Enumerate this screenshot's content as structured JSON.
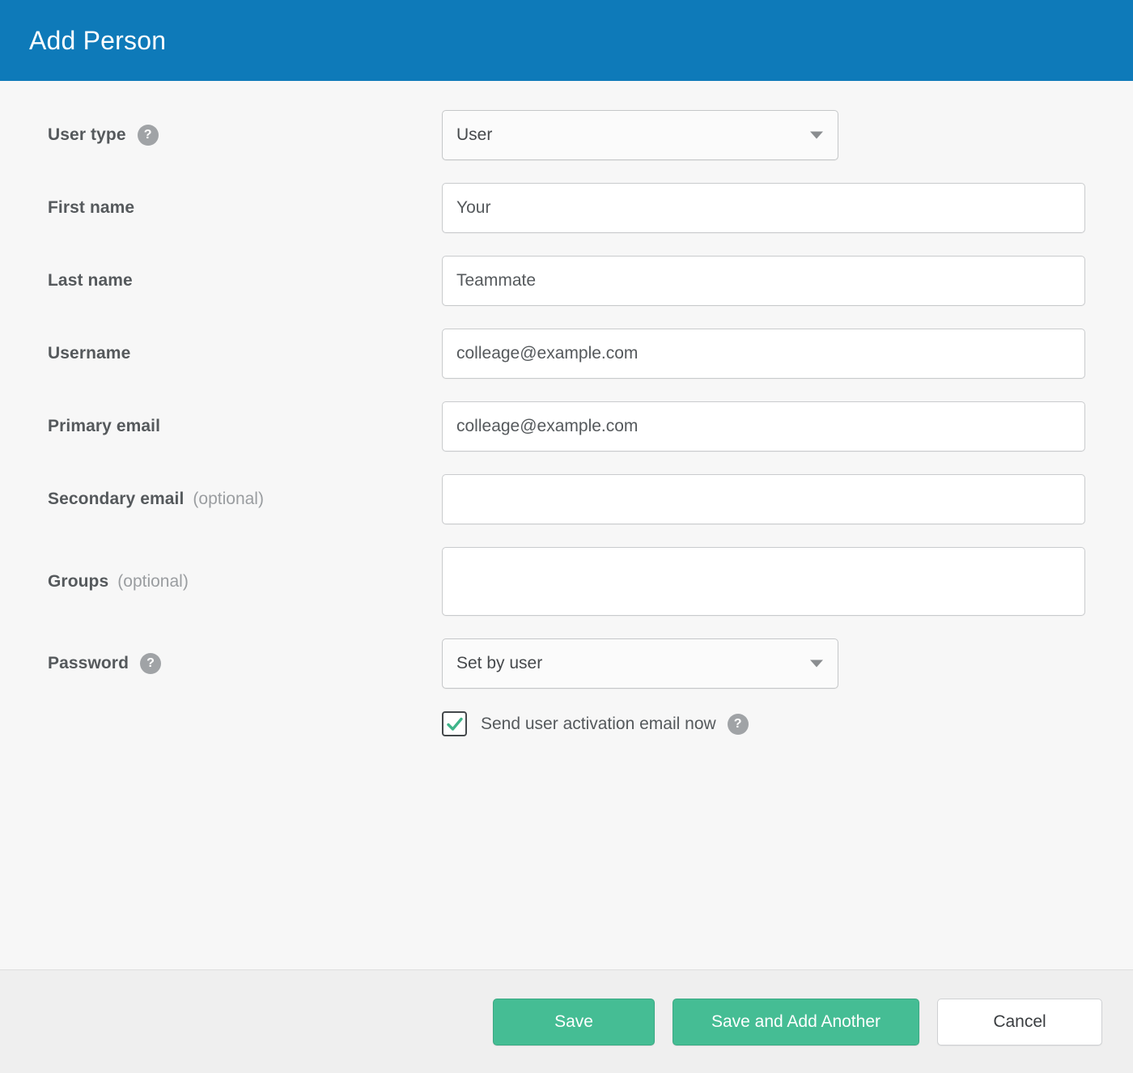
{
  "header": {
    "title": "Add Person",
    "background_color": "#0e7ab9",
    "title_color": "#ffffff"
  },
  "form": {
    "fields": [
      {
        "id": "user_type",
        "label": "User type",
        "optional_text": "",
        "has_help": true,
        "control": "select",
        "value": "User"
      },
      {
        "id": "first_name",
        "label": "First name",
        "optional_text": "",
        "has_help": false,
        "control": "text",
        "value": "Your",
        "placeholder": ""
      },
      {
        "id": "last_name",
        "label": "Last name",
        "optional_text": "",
        "has_help": false,
        "control": "text",
        "value": "Teammate",
        "placeholder": ""
      },
      {
        "id": "username",
        "label": "Username",
        "optional_text": "",
        "has_help": false,
        "control": "text",
        "value": "colleage@example.com",
        "placeholder": ""
      },
      {
        "id": "primary_email",
        "label": "Primary email",
        "optional_text": "",
        "has_help": false,
        "control": "text",
        "value": "colleage@example.com",
        "placeholder": ""
      },
      {
        "id": "secondary_email",
        "label": "Secondary email",
        "optional_text": "(optional)",
        "has_help": false,
        "control": "text",
        "value": "",
        "placeholder": ""
      },
      {
        "id": "groups",
        "label": "Groups",
        "optional_text": "(optional)",
        "has_help": false,
        "control": "textarea",
        "value": "",
        "placeholder": ""
      },
      {
        "id": "password",
        "label": "Password",
        "optional_text": "",
        "has_help": true,
        "control": "select",
        "value": "Set by user"
      }
    ],
    "checkbox": {
      "label": "Send user activation email now",
      "checked": true,
      "has_help": true,
      "check_color": "#3fb48a"
    },
    "help_icon_glyph": "?",
    "dropdown_icon": "chevron-down-icon"
  },
  "footer": {
    "save_label": "Save",
    "save_add_another_label": "Save and Add Another",
    "cancel_label": "Cancel",
    "primary_color": "#45bd94",
    "background_color": "#efefef"
  }
}
